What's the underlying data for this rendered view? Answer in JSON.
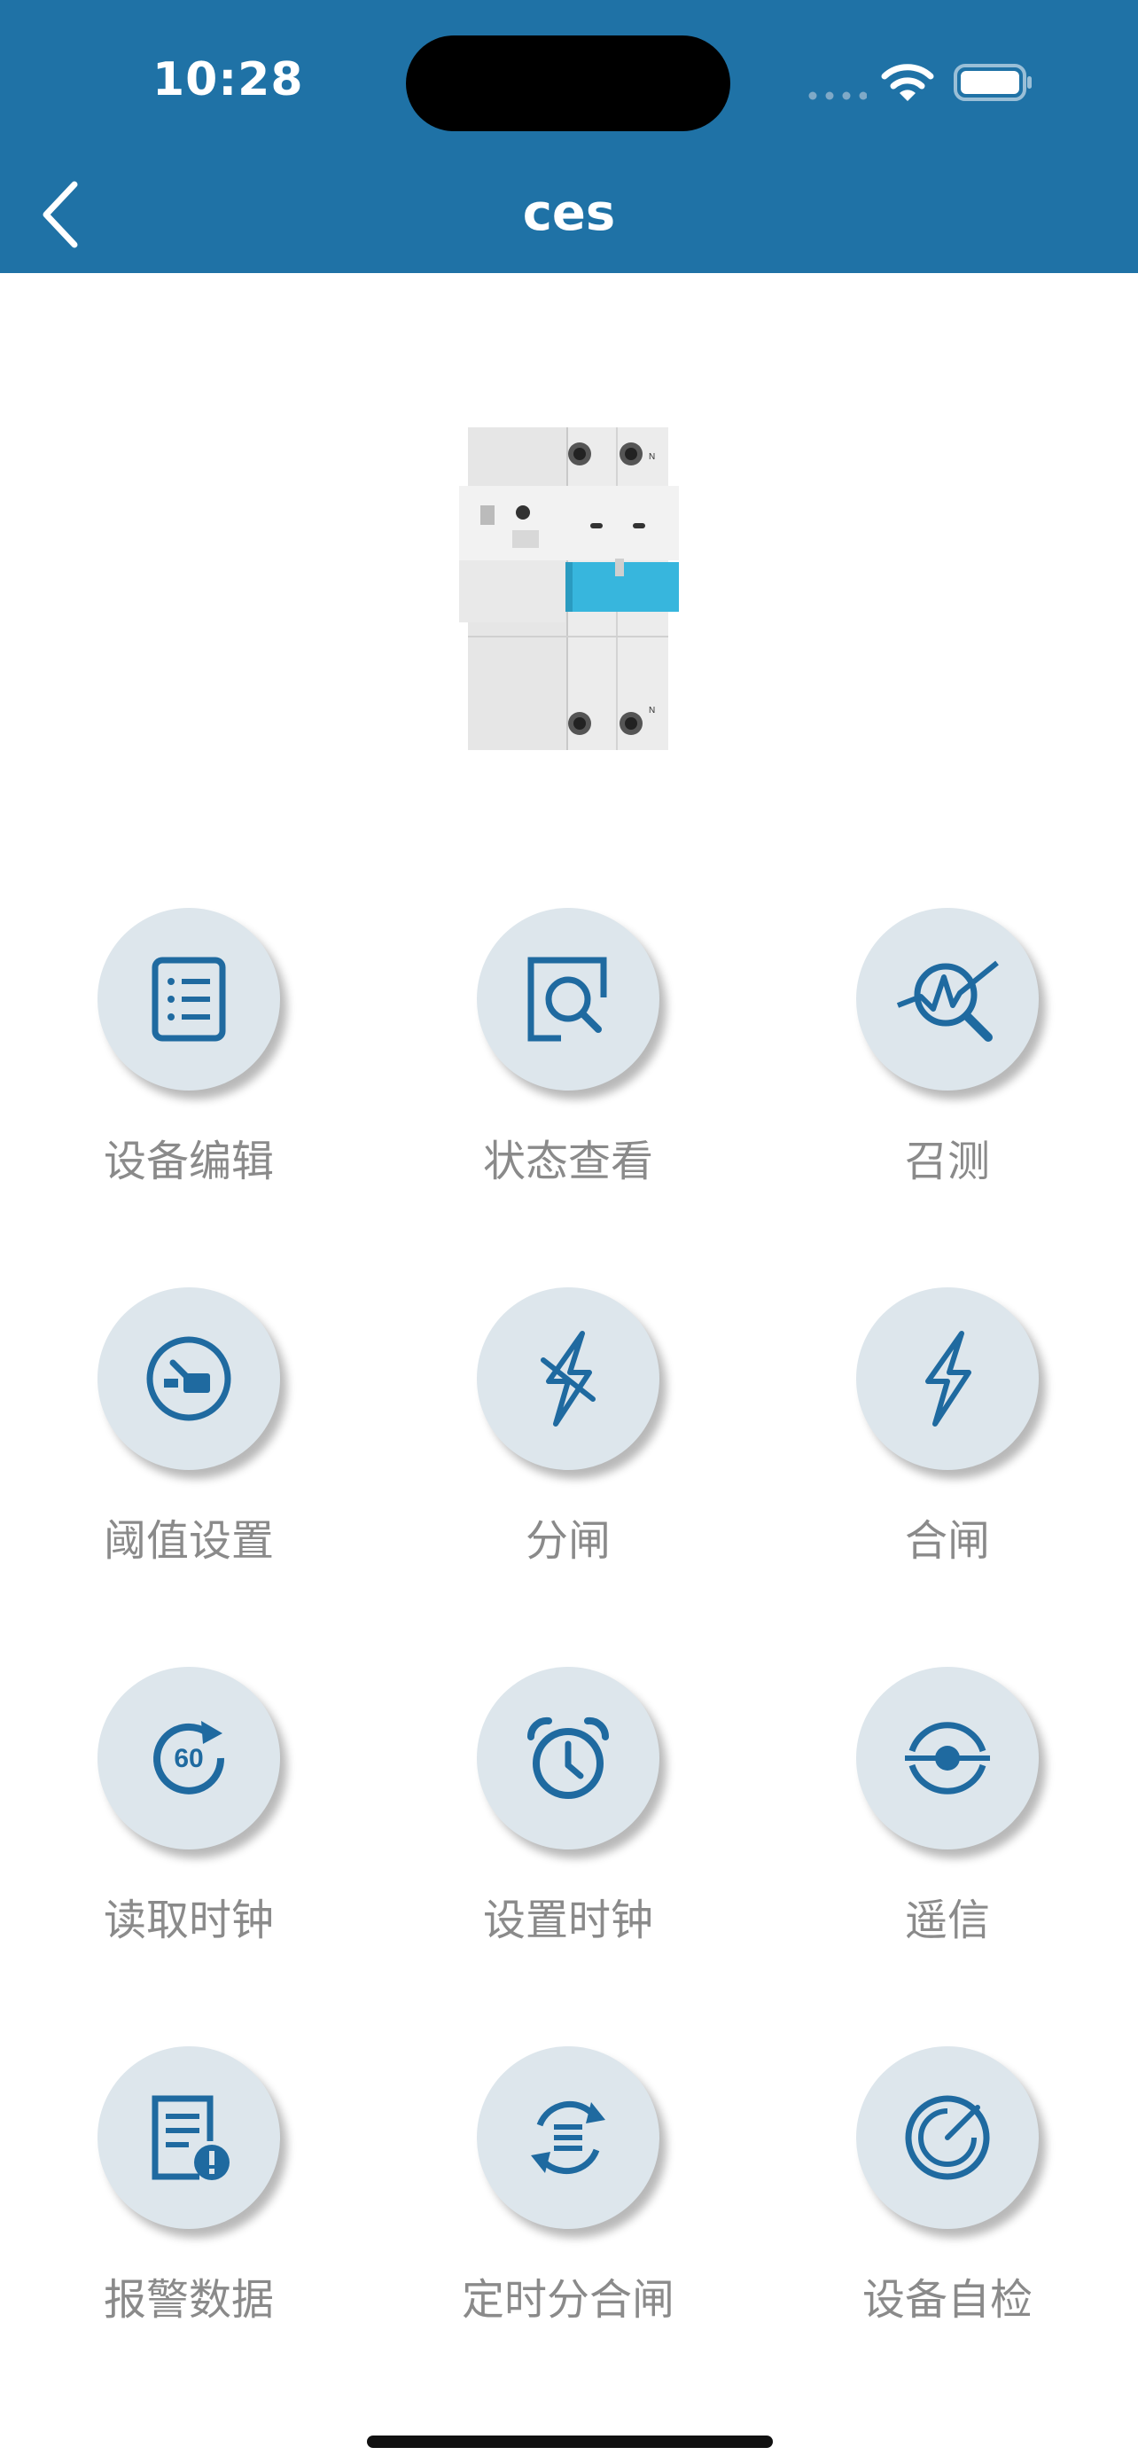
{
  "status_bar": {
    "time": "10:28"
  },
  "nav": {
    "title": "ces",
    "back_icon": "chevron-left-icon"
  },
  "colors": {
    "header": "#1f72a6",
    "icon": "#1f6aa0",
    "circle": "#dde6ec",
    "label": "#8a8a8a"
  },
  "device": {
    "image": "circuit-breaker-image"
  },
  "grid": [
    {
      "label": "设备编辑",
      "icon": "list-document-icon"
    },
    {
      "label": "状态查看",
      "icon": "search-status-icon"
    },
    {
      "label": "召测",
      "icon": "waveform-search-icon"
    },
    {
      "label": "阈值设置",
      "icon": "gauge-icon"
    },
    {
      "label": "分闸",
      "icon": "lightning-cross-icon"
    },
    {
      "label": "合闸",
      "icon": "lightning-icon"
    },
    {
      "label": "读取时钟",
      "icon": "timer-60-icon"
    },
    {
      "label": "设置时钟",
      "icon": "alarm-clock-icon"
    },
    {
      "label": "遥信",
      "icon": "remote-signal-icon"
    },
    {
      "label": "报警数据",
      "icon": "alert-document-icon"
    },
    {
      "label": "定时分合闸",
      "icon": "refresh-list-icon"
    },
    {
      "label": "设备自检",
      "icon": "radar-icon"
    }
  ]
}
